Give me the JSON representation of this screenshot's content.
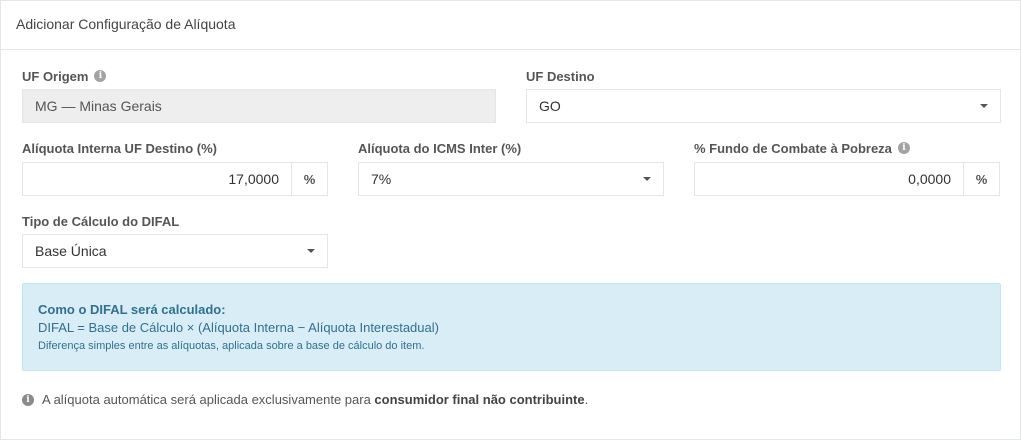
{
  "header": {
    "title": "Adicionar Configuração de Alíquota"
  },
  "uf_origem": {
    "label": "UF Origem",
    "value": "MG — Minas Gerais",
    "icon": "info-icon"
  },
  "uf_destino": {
    "label": "UF Destino",
    "value": "GO"
  },
  "aliquota_interna": {
    "label": "Alíquota Interna UF Destino (%)",
    "value": "17,0000",
    "addon": "%"
  },
  "aliquota_inter": {
    "label": "Alíquota do ICMS Inter (%)",
    "value": "7%"
  },
  "fundo_pobreza": {
    "label": "% Fundo de Combate à Pobreza",
    "value": "0,0000",
    "addon": "%",
    "icon": "info-icon"
  },
  "tipo_calculo": {
    "label": "Tipo de Cálculo do DIFAL",
    "value": "Base Única"
  },
  "alert": {
    "title": "Como o DIFAL será calculado:",
    "formula": "DIFAL = Base de Cálculo × (Alíquota Interna − Alíquota Interestadual)",
    "description": "Diferença simples entre as alíquotas, aplicada sobre a base de cálculo do item."
  },
  "note": {
    "prefix": "A alíquota automática será aplicada exclusivamente para ",
    "bold": "consumidor final não contribuinte",
    "suffix": "."
  },
  "colors": {
    "alert_bg": "#d9edf7",
    "alert_text": "#31708f",
    "readonly_bg": "#eeeeee"
  }
}
